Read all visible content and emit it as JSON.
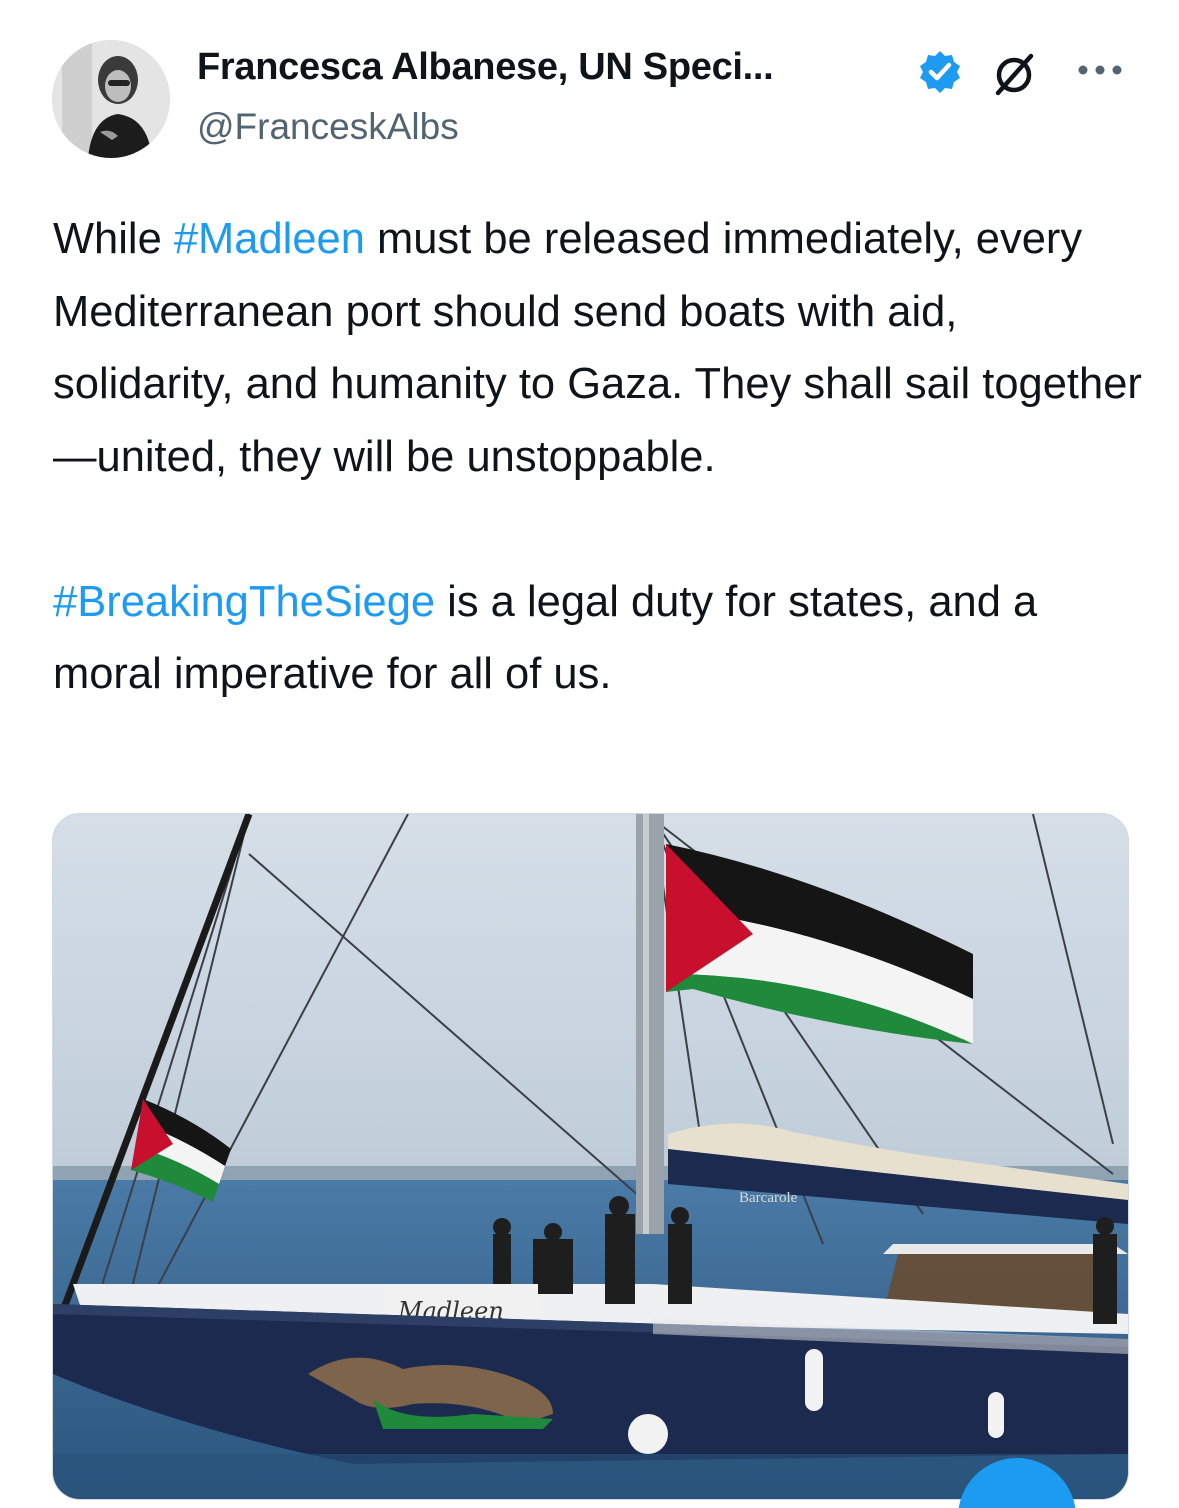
{
  "author": {
    "display_name": "Francesca Albanese, UN Speci...",
    "handle": "@FranceskAlbs",
    "avatar_icon": "profile-photo",
    "verified_icon": "verified-badge-icon",
    "affiliation_icon": "grok-slash-icon",
    "more_icon": "more-dots-icon"
  },
  "tweet": {
    "p1_before": "While ",
    "p1_hashtag": "#Madleen",
    "p1_after": " must be released immediately, every Mediterranean port should send boats with aid, solidarity, and humanity to Gaza. They shall sail together—united, they will be unstoppable.",
    "p2_hashtag": "#BreakingTheSiege",
    "p2_after": " is a legal duty for states, and a moral imperative for all of us."
  },
  "media": {
    "hull_name": "Madleen",
    "boom_name": "Barcarole"
  },
  "colors": {
    "hashtag": "#1d9bf0",
    "verified": "#1d9bf0",
    "hull": "#1b2a4e",
    "sea": "#2f5f8a",
    "sky": "#c9d5e0"
  }
}
